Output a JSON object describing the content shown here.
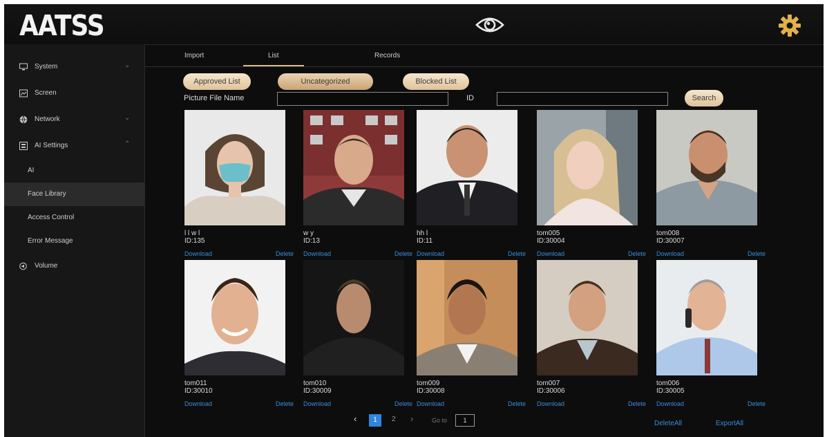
{
  "header": {
    "logo": "AATSS"
  },
  "sidebar": {
    "items": [
      {
        "label": "System",
        "icon": "monitor-icon",
        "expandable": true
      },
      {
        "label": "Screen",
        "icon": "screen-icon",
        "expandable": false
      },
      {
        "label": "Network",
        "icon": "globe-icon",
        "expandable": true
      },
      {
        "label": "AI Settings",
        "icon": "ai-settings-icon",
        "expandable": true
      },
      {
        "label": "AI",
        "sub": true
      },
      {
        "label": "Face Library",
        "sub": true,
        "active": true
      },
      {
        "label": "Access Control",
        "sub": true
      },
      {
        "label": "Error Message",
        "sub": true
      },
      {
        "label": "Volume",
        "icon": "volume-icon",
        "expandable": false
      }
    ]
  },
  "tabs": [
    {
      "label": "Import"
    },
    {
      "label": "List",
      "active": true
    },
    {
      "label": "Records"
    }
  ],
  "filters": {
    "approved": "Approved List",
    "uncategorized": "Uncategorized",
    "blocked": "Blocked List",
    "selected": "Uncategorized"
  },
  "search": {
    "picture_label": "Picture File Name",
    "picture_value": "",
    "id_label": "ID",
    "id_value": "",
    "button": "Search"
  },
  "cards": [
    {
      "name": "l l w l",
      "id": "ID:135",
      "download": "Download",
      "delete": "Delete"
    },
    {
      "name": "w y",
      "id": "ID:13",
      "download": "Download",
      "delete": "Delete"
    },
    {
      "name": "hh l",
      "id": "ID:11",
      "download": "Download",
      "delete": "Delete"
    },
    {
      "name": "tom005",
      "id": "ID:30004",
      "download": "Download",
      "delete": "Delete"
    },
    {
      "name": "tom008",
      "id": "ID:30007",
      "download": "Download",
      "delete": "Delete"
    },
    {
      "name": "tom011",
      "id": "ID:30010",
      "download": "Download",
      "delete": "Delete"
    },
    {
      "name": "tom010",
      "id": "ID:30009",
      "download": "Download",
      "delete": "Delete"
    },
    {
      "name": "tom009",
      "id": "ID:30008",
      "download": "Download",
      "delete": "Delete"
    },
    {
      "name": "tom007",
      "id": "ID:30006",
      "download": "Download",
      "delete": "Delete"
    },
    {
      "name": "tom006",
      "id": "ID:30005",
      "download": "Download",
      "delete": "Delete"
    }
  ],
  "pagination": {
    "prev": "‹",
    "current": "1",
    "next_page": "2",
    "next": "›",
    "goto_label": "Go to",
    "goto_value": "1"
  },
  "actions": {
    "delete_all": "DeleteAll",
    "export_all": "ExportAll"
  },
  "colors": {
    "accent": "#d9b98f",
    "link": "#3b8ddb",
    "page_active": "#2e86de"
  }
}
